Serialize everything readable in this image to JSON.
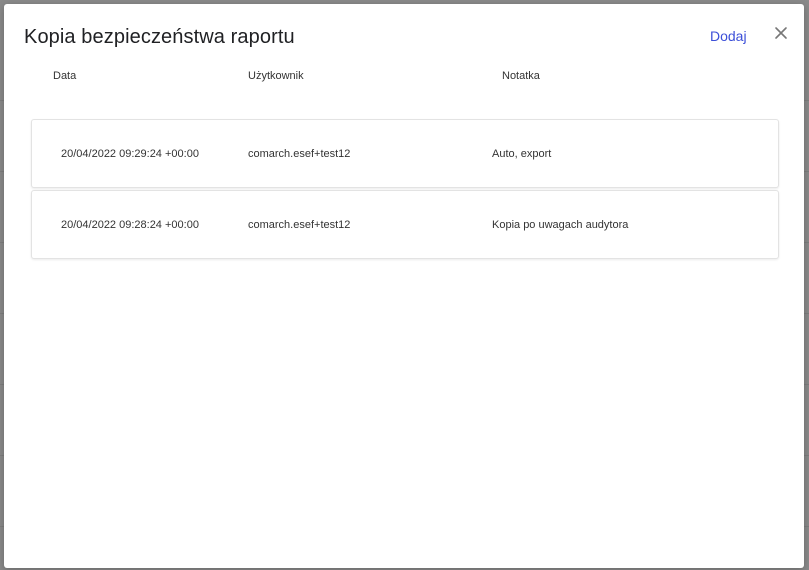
{
  "dialog": {
    "title": "Kopia bezpieczeństwa raportu",
    "add_label": "Dodaj",
    "close_icon": "close-icon"
  },
  "table": {
    "headers": [
      "Data",
      "Użytkownik",
      "Notatka"
    ],
    "rows": [
      {
        "date": "20/04/2022 09:29:24 +00:00",
        "user": "comarch.esef+test12",
        "note": "Auto, export"
      },
      {
        "date": "20/04/2022 09:28:24 +00:00",
        "user": "comarch.esef+test12",
        "note": "Kopia po uwagach audytora"
      }
    ]
  }
}
